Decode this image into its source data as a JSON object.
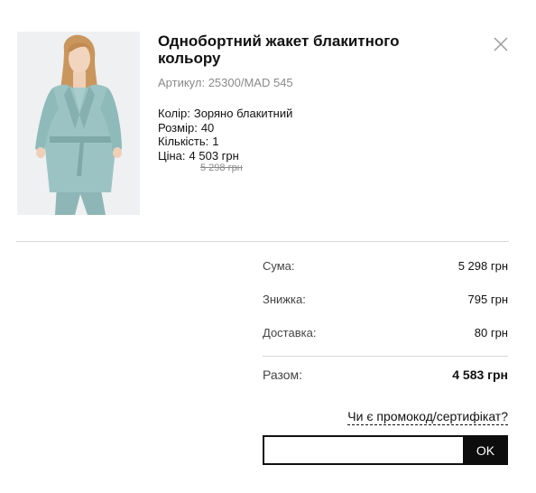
{
  "product": {
    "title": "Однобортний жакет блакитного кольору",
    "sku_label": "Артикул:",
    "sku_value": "25300/MAD 545",
    "color_label": "Колір:",
    "color_value": "Зоряно блакитний",
    "size_label": "Розмір:",
    "size_value": "40",
    "qty_label": "Кількість:",
    "qty_value": "1",
    "price_label": "Ціна:",
    "price_value": "4 503 грн",
    "old_price": "5 298 грн"
  },
  "summary": {
    "sum_label": "Сума:",
    "sum_value": "5 298 грн",
    "discount_label": "Знижка:",
    "discount_value": "795 грн",
    "delivery_label": "Доставка:",
    "delivery_value": "80 грн",
    "total_label": "Разом:",
    "total_value": "4 583 грн"
  },
  "promo": {
    "link_text": "Чи є промокод/сертифікат?",
    "input_value": "",
    "input_placeholder": "",
    "ok_label": "OK"
  },
  "icons": {
    "close": "close-icon",
    "product_image": "product-photo"
  },
  "colors": {
    "accent": "#0d0d0d",
    "jacket": "#9cc3c3",
    "muted_text": "#8a8a8a",
    "divider": "#d6d6d6"
  }
}
